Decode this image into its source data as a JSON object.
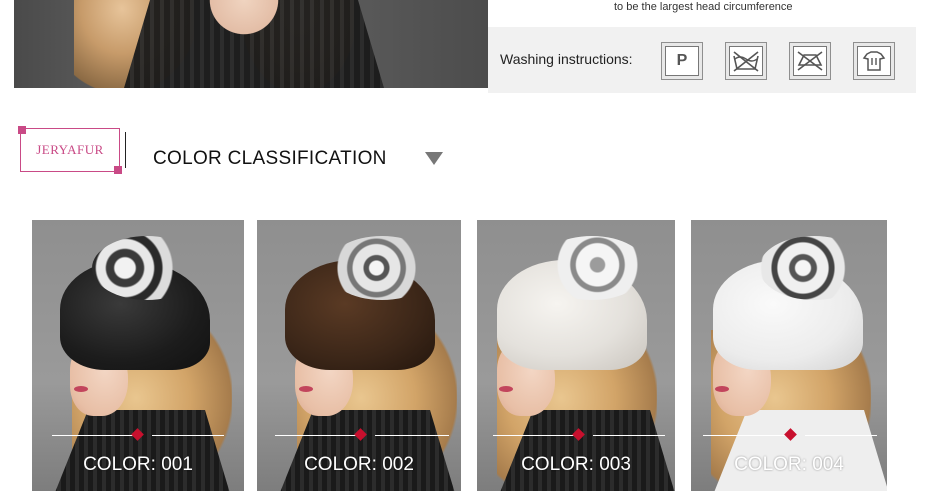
{
  "top": {
    "measure_note": "to be the largest head circumference",
    "washing_label": "Washing instructions:",
    "wash_icons": [
      {
        "name": "dry-clean-p-icon",
        "text": "P"
      },
      {
        "name": "no-wash-icon",
        "text": ""
      },
      {
        "name": "no-tumble-dry-icon",
        "text": ""
      },
      {
        "name": "hang-dry-icon",
        "text": ""
      }
    ]
  },
  "header": {
    "logo_text": "JERYAFUR",
    "title": "COLOR CLASSIFICATION",
    "brand_color": "#c94a86"
  },
  "cards": [
    {
      "label": "COLOR: 001",
      "hat_color": "#1c1c1c",
      "accent": "#cfcfcf"
    },
    {
      "label": "COLOR: 002",
      "hat_color": "#3b2618",
      "accent": "#d8d8d8"
    },
    {
      "label": "COLOR: 003",
      "hat_color": "#e4e1dc",
      "accent": "#9c9c9c"
    },
    {
      "label": "COLOR: 004",
      "hat_color": "#ececec",
      "accent": "#555555"
    }
  ],
  "colors": {
    "diamond": "#c8102e",
    "wash_band": "#f1f1f1"
  }
}
